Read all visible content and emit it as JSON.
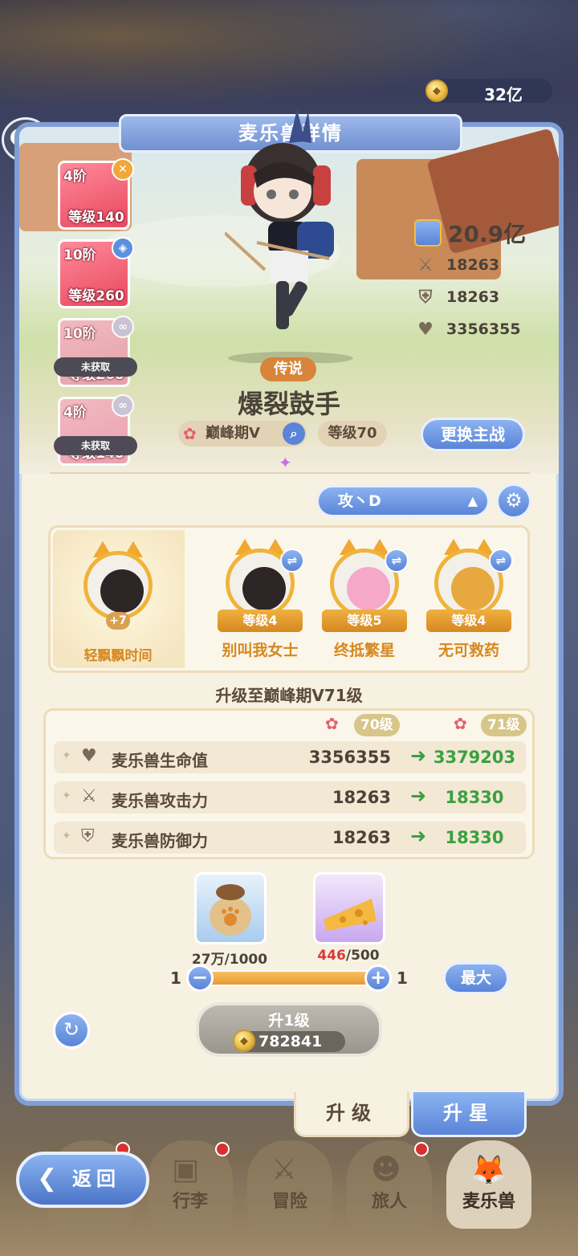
{
  "header": {
    "gold_amount": "32亿"
  },
  "panel": {
    "title": "麦乐兽详情"
  },
  "skills": [
    {
      "tier": "4阶",
      "level": "等级140",
      "badge": "x",
      "locked": false,
      "locked_label": ""
    },
    {
      "tier": "10阶",
      "level": "等级260",
      "badge": "shield",
      "locked": false,
      "locked_label": ""
    },
    {
      "tier": "10阶",
      "level": "等级260",
      "badge": "link",
      "locked": true,
      "locked_label": "未获取"
    },
    {
      "tier": "4阶",
      "level": "等级140",
      "badge": "link",
      "locked": true,
      "locked_label": "未获取"
    }
  ],
  "character": {
    "rarity": "传说",
    "name": "爆裂鼓手",
    "stage": "巅峰期V",
    "level": "等级70",
    "power": "20.9亿",
    "attack": "18263",
    "defense": "18263",
    "hp": "3356355",
    "switch_label": "更换主战"
  },
  "formation": {
    "selected": "攻丶D"
  },
  "team": {
    "leader": {
      "name": "轻飘飘时间",
      "bonus": "+7"
    },
    "members": [
      {
        "name": "别叫我女士",
        "level": "等级4"
      },
      {
        "name": "终抵繁星",
        "level": "等级5"
      },
      {
        "name": "无可救药",
        "level": "等级4"
      }
    ]
  },
  "upgrade": {
    "title": "升级至巅峰期V71级",
    "from_level": "70级",
    "to_level": "71级",
    "rows": [
      {
        "label": "麦乐兽生命值",
        "old": "3356355",
        "new": "3379203"
      },
      {
        "label": "麦乐兽攻击力",
        "old": "18263",
        "new": "18330"
      },
      {
        "label": "麦乐兽防御力",
        "old": "18263",
        "new": "18330"
      }
    ]
  },
  "materials": {
    "food_count": "27万/1000",
    "cheese_have": "446",
    "cheese_need": "/500",
    "min": "1",
    "max": "1",
    "max_label": "最大"
  },
  "level_button": {
    "label": "升1级",
    "cost": "782841"
  },
  "tabs": {
    "upgrade": "升级",
    "star": "升星"
  },
  "nav": {
    "back": "返回",
    "items": [
      "行李",
      "冒险",
      "旅人",
      "麦乐兽"
    ]
  }
}
